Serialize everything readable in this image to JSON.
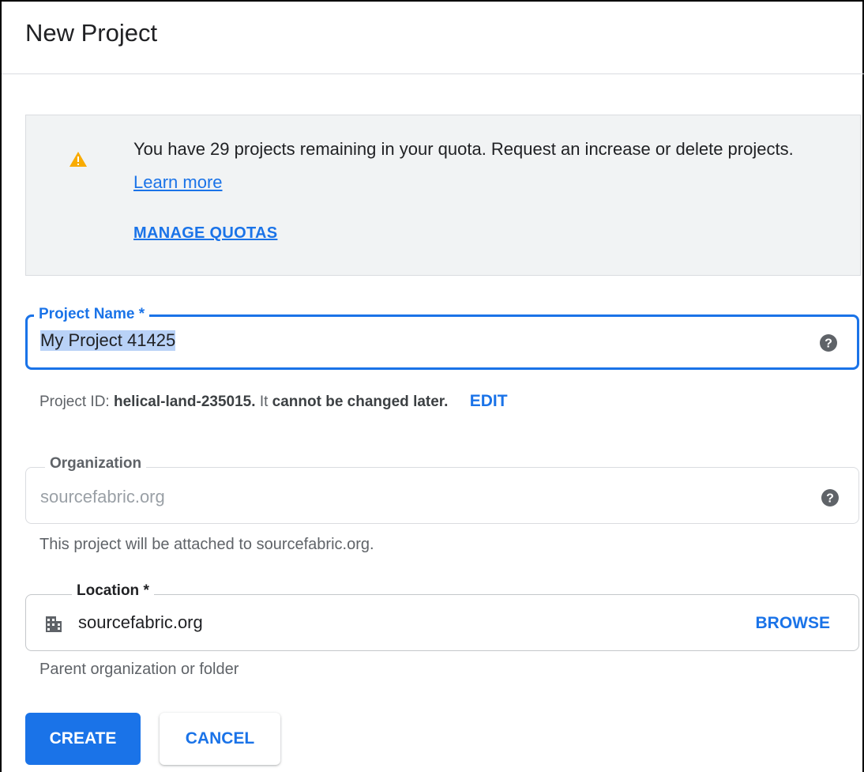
{
  "dialog": {
    "title": "New Project"
  },
  "quota_notice": {
    "icon": "warning-icon",
    "message": "You have 29 projects remaining in your quota. Request an increase or delete projects.",
    "learn_more": "Learn more",
    "manage_quotas": "MANAGE QUOTAS"
  },
  "project_name": {
    "label": "Project Name *",
    "value": "My Project 41425",
    "help_icon": "help-icon"
  },
  "project_id": {
    "prefix": "Project ID:",
    "id": "helical-land-235015.",
    "middle": "It",
    "emphasis": "cannot be changed later.",
    "edit": "EDIT"
  },
  "organization": {
    "label": "Organization",
    "value": "sourcefabric.org",
    "hint": "This project will be attached to sourcefabric.org.",
    "help_icon": "help-icon"
  },
  "location": {
    "label": "Location *",
    "value": "sourcefabric.org",
    "icon": "building-icon",
    "browse": "BROWSE",
    "hint": "Parent organization or folder"
  },
  "actions": {
    "create": "CREATE",
    "cancel": "CANCEL"
  },
  "colors": {
    "accent": "#1a73e8",
    "warning": "#f9ab00",
    "notice_bg": "#f1f3f4"
  }
}
